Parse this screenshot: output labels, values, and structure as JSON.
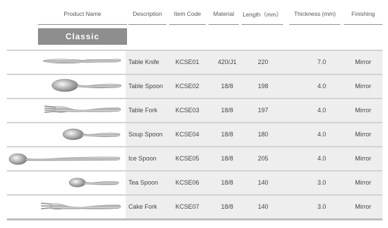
{
  "headers": {
    "product_name": "Product Name",
    "description": "Description",
    "item_code": "Item Code",
    "material": "Material",
    "length": "Length（mm）",
    "thickness": "Thickness (mm)",
    "finishing": "Finishing"
  },
  "section": {
    "label": "Classic"
  },
  "rows": [
    {
      "icon": "table-knife-icon",
      "description": "Table Knife",
      "item_code": "KCSE01",
      "material": "420/J1",
      "length": "220",
      "thickness": "7.0",
      "finishing": "Mirror"
    },
    {
      "icon": "table-spoon-icon",
      "description": "Table Spoon",
      "item_code": "KCSE02",
      "material": "18/8",
      "length": "198",
      "thickness": "4.0",
      "finishing": "Mirror"
    },
    {
      "icon": "table-fork-icon",
      "description": "Table Fork",
      "item_code": "KCSE03",
      "material": "18/8",
      "length": "197",
      "thickness": "4.0",
      "finishing": "Mirror"
    },
    {
      "icon": "soup-spoon-icon",
      "description": "Soup Spoon",
      "item_code": "KCSE04",
      "material": "18/8",
      "length": "180",
      "thickness": "4.0",
      "finishing": "Mirror"
    },
    {
      "icon": "ice-spoon-icon",
      "description": "Ice Spoon",
      "item_code": "KCSE05",
      "material": "18/8",
      "length": "205",
      "thickness": "4.0",
      "finishing": "Mirror"
    },
    {
      "icon": "tea-spoon-icon",
      "description": "Tea Spoon",
      "item_code": "KCSE06",
      "material": "18/8",
      "length": "140",
      "thickness": "3.0",
      "finishing": "Mirror"
    },
    {
      "icon": "cake-fork-icon",
      "description": "Cake Fork",
      "item_code": "KCSE07",
      "material": "18/8",
      "length": "140",
      "thickness": "3.0",
      "finishing": "Mirror"
    }
  ]
}
